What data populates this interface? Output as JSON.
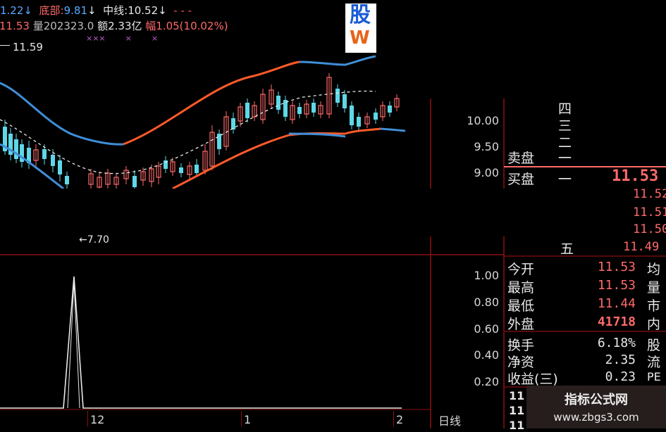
{
  "header": {
    "row1": {
      "upper": "1.22",
      "upper_arrow": "↓",
      "bottom_label": "底部:",
      "bottom_value": "9.81",
      "bottom_arrow": "↓",
      "mid_label": "中线:",
      "mid_value": "10.52",
      "mid_arrow": "↓",
      "dashes": "- -   -"
    },
    "row2": {
      "close": "收11.53",
      "volume": "量202323.0",
      "amount": "额2.33亿",
      "change": "幅1.05(10.02%)"
    },
    "marks": "×××        ×        ×",
    "high_marker": "11.59",
    "low_marker": "←7.70"
  },
  "logo": {
    "text_top": "股",
    "text_bottom": "W"
  },
  "price_axis": [
    "10.00",
    "9.50",
    "9.00"
  ],
  "indicator_axis": [
    "1.00",
    "0.80",
    "0.60",
    "0.40",
    "0.20"
  ],
  "date_axis": [
    "12",
    "1",
    "2"
  ],
  "period_label": "日线",
  "order_book": {
    "sell_label": "卖盘",
    "buy_label": "买盘",
    "sell_levels": [
      "四",
      "三",
      "二",
      "一"
    ],
    "buy_level_1": "一",
    "buy_level_5": "五",
    "buy1_price": "11.53",
    "buy_prices": [
      "11.52",
      "11.51",
      "11.50"
    ],
    "buy5_price": "11.49"
  },
  "stats": [
    {
      "label": "今开",
      "value": "11.53",
      "right": "均"
    },
    {
      "label": "最高",
      "value": "11.53",
      "right": "量"
    },
    {
      "label": "最低",
      "value": "11.44",
      "right": "市"
    },
    {
      "label": "外盘",
      "value": "41718",
      "right": "内"
    }
  ],
  "stats2": [
    {
      "label": "换手",
      "value": "6.18%",
      "right": "股"
    },
    {
      "label": "净资",
      "value": "2.35",
      "right": "流"
    },
    {
      "label": "收益(三)",
      "value": "0.23",
      "right": "PE"
    }
  ],
  "trade_rows": [
    "11",
    "11",
    "11"
  ],
  "watermark": {
    "title": "指标公式网",
    "url": "www.zbgs3.com"
  },
  "colors": {
    "upper_band": "#ff5a2a",
    "lower_band": "#3f8fd8",
    "candle_up": "#ff6a6a",
    "candle_down": "#5fd7e6",
    "grid": "#8a1010",
    "highlight_line": "#ff6a6a"
  }
}
